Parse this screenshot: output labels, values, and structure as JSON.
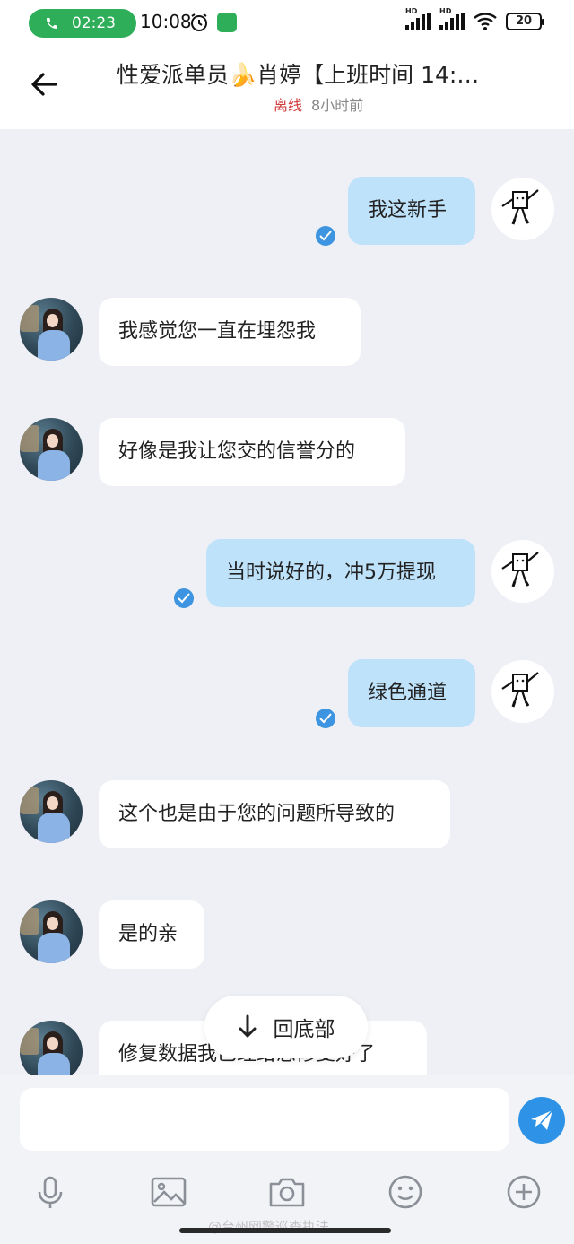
{
  "status_bar": {
    "call_timer": "02:23",
    "time": "10:08",
    "network_label": "HD",
    "battery": "20"
  },
  "header": {
    "title": "性爱派单员🍌肖婷【上班时间 14:…",
    "status": "离线",
    "last_seen": "8小时前"
  },
  "messages": [
    {
      "side": "out",
      "text": "我这新手"
    },
    {
      "side": "in",
      "text": "我感觉您一直在埋怨我"
    },
    {
      "side": "in",
      "text": "好像是我让您交的信誉分的"
    },
    {
      "side": "out",
      "text": "当时说好的，冲5万提现"
    },
    {
      "side": "out",
      "text": "绿色通道"
    },
    {
      "side": "in",
      "text": "这个也是由于您的问题所导致的"
    },
    {
      "side": "in",
      "text": "是的亲"
    },
    {
      "side": "in",
      "text": "修复数据我已经给您修复好了"
    }
  ],
  "scroll_bottom_label": "回底部",
  "input": {
    "placeholder": ""
  },
  "toolbar": [
    "mic-icon",
    "image-icon",
    "camera-icon",
    "emoji-icon",
    "plus-icon"
  ],
  "watermark": "@台州网警巡查执法",
  "colors": {
    "accent": "#2e93e6",
    "outgoing_bubble": "#bfe2fb",
    "offline": "#d23b3b",
    "call_green": "#2fae59"
  }
}
